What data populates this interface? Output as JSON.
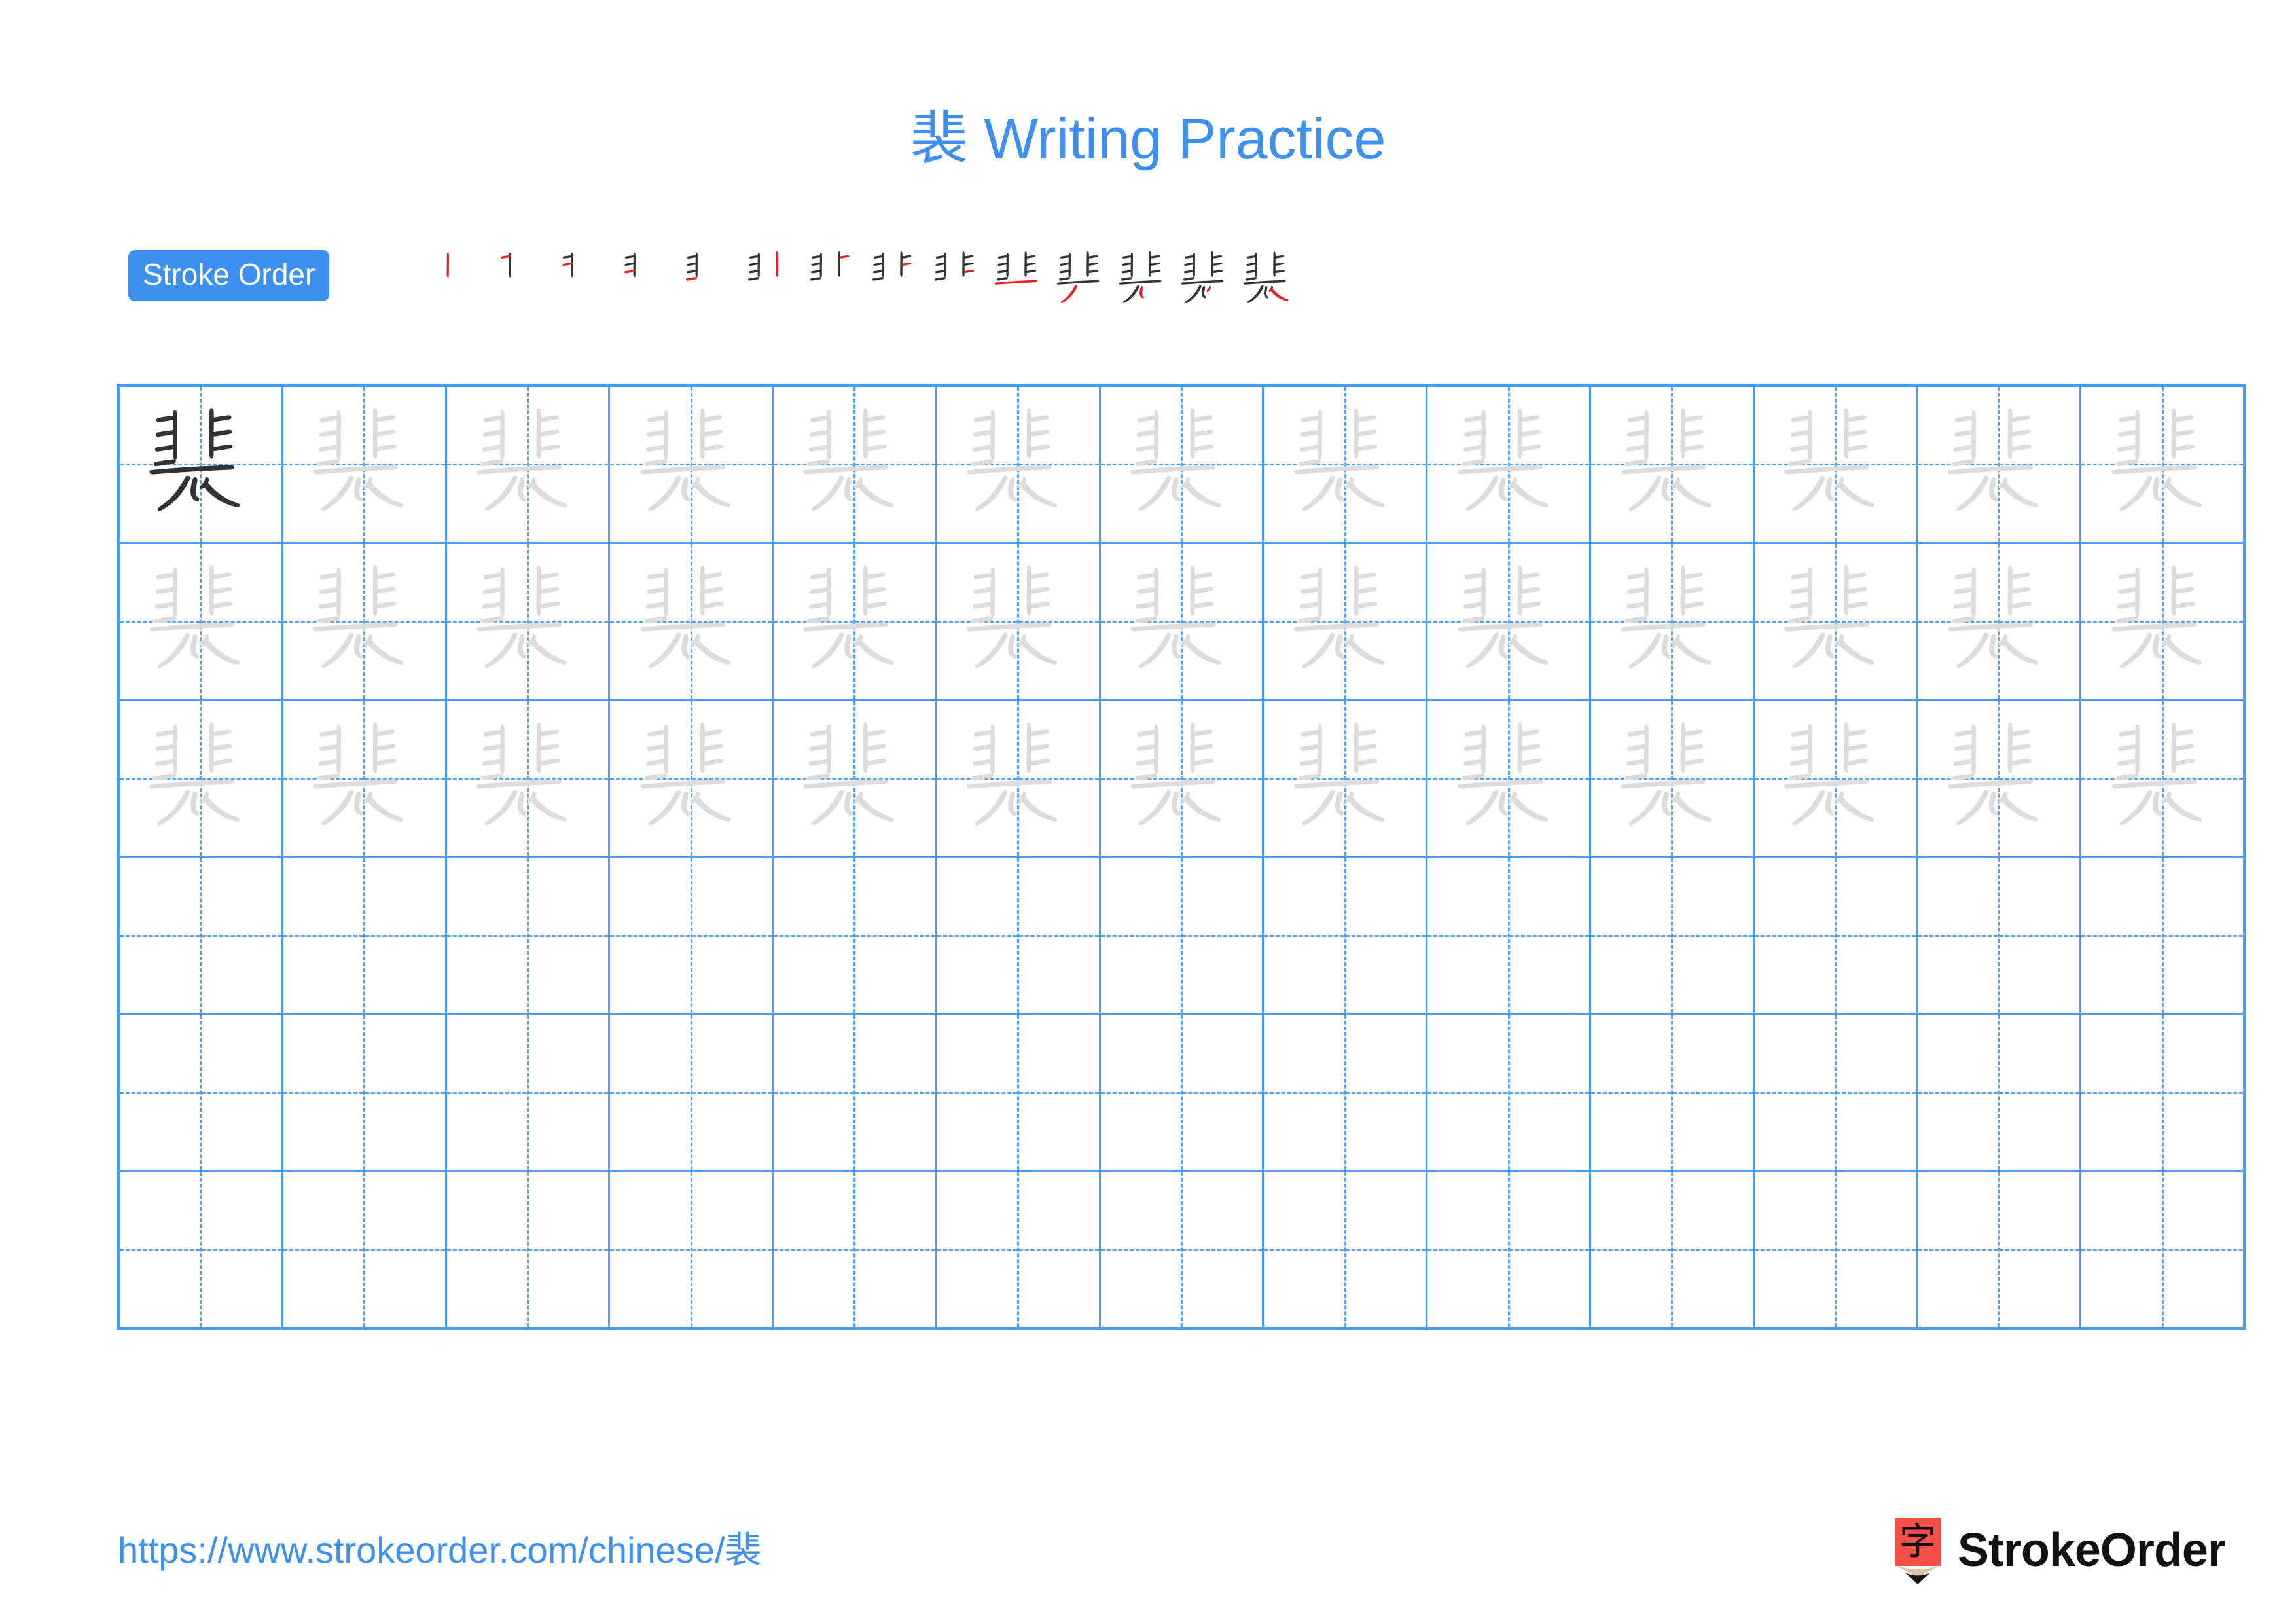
{
  "character": "裴",
  "title": {
    "character": "裴",
    "text": " Writing Practice",
    "color": "#3d90ee"
  },
  "stroke_order": {
    "badge_label": "Stroke Order",
    "badge_bg": "#3d90ee",
    "badge_text_color": "#ffffff",
    "total_strokes": 14,
    "new_stroke_color": "#ee1c25",
    "existing_stroke_color": "#333333",
    "steps": [
      {
        "index": 1,
        "strokes_shown": 1,
        "new_stroke": 1
      },
      {
        "index": 2,
        "strokes_shown": 2,
        "new_stroke": 2
      },
      {
        "index": 3,
        "strokes_shown": 3,
        "new_stroke": 3
      },
      {
        "index": 4,
        "strokes_shown": 4,
        "new_stroke": 4
      },
      {
        "index": 5,
        "strokes_shown": 5,
        "new_stroke": 5
      },
      {
        "index": 6,
        "strokes_shown": 6,
        "new_stroke": 6
      },
      {
        "index": 7,
        "strokes_shown": 7,
        "new_stroke": 7
      },
      {
        "index": 8,
        "strokes_shown": 8,
        "new_stroke": 8
      },
      {
        "index": 9,
        "strokes_shown": 9,
        "new_stroke": 9
      },
      {
        "index": 10,
        "strokes_shown": 10,
        "new_stroke": 10
      },
      {
        "index": 11,
        "strokes_shown": 11,
        "new_stroke": 11
      },
      {
        "index": 12,
        "strokes_shown": 12,
        "new_stroke": 12
      },
      {
        "index": 13,
        "strokes_shown": 13,
        "new_stroke": 13
      },
      {
        "index": 14,
        "strokes_shown": 14,
        "new_stroke": 14
      }
    ]
  },
  "grid": {
    "columns": 13,
    "rows": 6,
    "border_color": "#4a9af0",
    "guide_color": "#55a2f2",
    "model_glyph_color": "#333333",
    "trace_glyph_color": "#dcdcdc",
    "row_fill": [
      {
        "row": 1,
        "mode": "model-then-trace",
        "filled_cells": 13
      },
      {
        "row": 2,
        "mode": "trace",
        "filled_cells": 13
      },
      {
        "row": 3,
        "mode": "trace",
        "filled_cells": 13
      },
      {
        "row": 4,
        "mode": "blank",
        "filled_cells": 0
      },
      {
        "row": 5,
        "mode": "blank",
        "filled_cells": 0
      },
      {
        "row": 6,
        "mode": "blank",
        "filled_cells": 0
      }
    ]
  },
  "footer": {
    "url": "https://www.strokeorder.com/chinese/裴",
    "url_color": "#3d90ee",
    "brand_name": "StrokeOrder",
    "brand_mark_char": "字",
    "brand_mark_body_color": "#f4504a",
    "brand_mark_wood_color": "#e0c3a0",
    "brand_mark_tip_color": "#111111"
  }
}
